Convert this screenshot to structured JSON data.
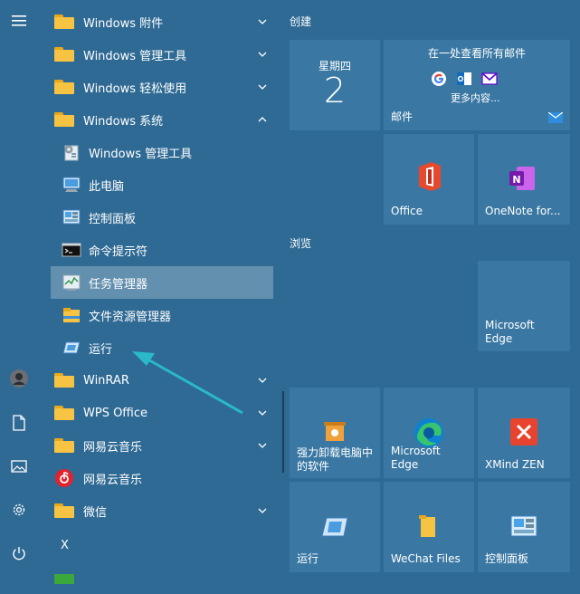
{
  "rail": {
    "icons": [
      "hamburger-icon",
      "user-avatar",
      "document-icon",
      "pictures-icon",
      "settings-icon",
      "power-icon"
    ]
  },
  "list": {
    "folders": [
      {
        "label": "Windows 附件"
      },
      {
        "label": "Windows 管理工具"
      },
      {
        "label": "Windows 轻松使用"
      },
      {
        "label": "Windows 系统"
      }
    ],
    "system_items": [
      {
        "label": "Windows 管理工具"
      },
      {
        "label": "此电脑"
      },
      {
        "label": "控制面板"
      },
      {
        "label": "命令提示符"
      },
      {
        "label": "任务管理器"
      },
      {
        "label": "文件资源管理器"
      },
      {
        "label": "运行"
      }
    ],
    "more": [
      {
        "label": "WinRAR"
      },
      {
        "label": "WPS Office"
      },
      {
        "label": "网易云音乐"
      },
      {
        "label": "网易云音乐"
      },
      {
        "label": "微信"
      }
    ],
    "letter_x": "X"
  },
  "tiles": {
    "group_create": "创建",
    "group_browse": "浏览",
    "calendar": {
      "weekday": "星期四",
      "day": "2"
    },
    "mail": {
      "headline": "在一处查看所有邮件",
      "more": "更多内容...",
      "label": "邮件"
    },
    "office": "Office",
    "onenote": "OneNote for...",
    "edge_large": "Microsoft Edge",
    "uninstall": "强力卸载电脑中的软件",
    "edge": "Microsoft Edge",
    "xmind": "XMind ZEN",
    "run": "运行",
    "wechat_files": "WeChat Files",
    "control_panel": "控制面板"
  },
  "colors": {
    "background": "#2f6a94",
    "tile": "#3a78a3",
    "highlight": "#5c8db3",
    "arrow": "#29b9c8"
  }
}
